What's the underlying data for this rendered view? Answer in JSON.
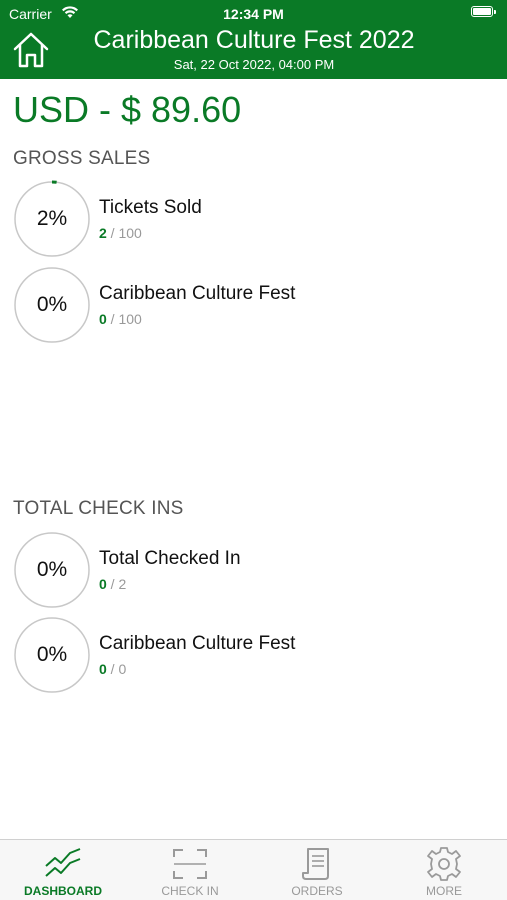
{
  "status_bar": {
    "carrier": "Carrier",
    "time": "12:34 PM"
  },
  "header": {
    "title": "Caribbean Culture Fest 2022",
    "date": "Sat, 22 Oct 2022, 04:00 PM"
  },
  "total_sales": "USD - $ 89.60",
  "gross_sales": {
    "title": "GROSS SALES",
    "items": [
      {
        "percent_label": "2%",
        "progress": 0.02,
        "label": "Tickets Sold",
        "current": "2",
        "separator": " / ",
        "total": "100"
      },
      {
        "percent_label": "0%",
        "progress": 0,
        "label": "Caribbean Culture Fest",
        "current": "0",
        "separator": " / ",
        "total": "100"
      }
    ]
  },
  "check_ins": {
    "title": "TOTAL CHECK INS",
    "items": [
      {
        "percent_label": "0%",
        "progress": 0,
        "label": "Total Checked In",
        "current": "0",
        "separator": " / ",
        "total": "2"
      },
      {
        "percent_label": "0%",
        "progress": 0,
        "label": "Caribbean Culture Fest",
        "current": "0",
        "separator": " / ",
        "total": "0"
      }
    ]
  },
  "tabbar": {
    "tabs": [
      {
        "label": "DASHBOARD",
        "icon": "chart-line-icon",
        "active": true
      },
      {
        "label": "CHECK IN",
        "icon": "scan-icon",
        "active": false
      },
      {
        "label": "ORDERS",
        "icon": "receipt-icon",
        "active": false
      },
      {
        "label": "MORE",
        "icon": "gear-icon",
        "active": false
      }
    ]
  },
  "colors": {
    "brand": "#0a7a26",
    "ring_track": "#c8c8c8",
    "muted": "#999999"
  }
}
